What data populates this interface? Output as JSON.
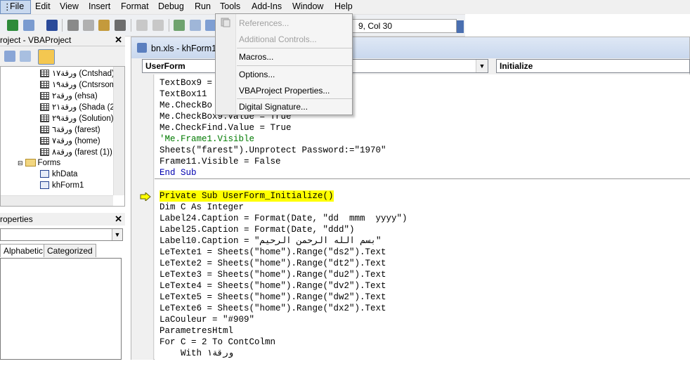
{
  "menubar": {
    "items": [
      "File",
      "Edit",
      "View",
      "Insert",
      "Format",
      "Debug",
      "Run",
      "Tools",
      "Add-Ins",
      "Window",
      "Help"
    ],
    "active": "Tools"
  },
  "toolbar": {
    "position_text": "9, Col 30"
  },
  "tools_menu": {
    "items": [
      {
        "label": "References...",
        "enabled": false
      },
      {
        "label": "Additional Controls...",
        "enabled": false
      },
      {
        "label": "Macros...",
        "enabled": true
      },
      {
        "label": "Options...",
        "enabled": true
      },
      {
        "label": "VBAProject Properties...",
        "enabled": true
      },
      {
        "label": "Digital Signature...",
        "enabled": true
      }
    ]
  },
  "project_explorer": {
    "title": "roject - VBAProject",
    "close_glyph": "✕",
    "tree": [
      {
        "label": "ورقة١٧ (Cntshad)",
        "type": "sheet"
      },
      {
        "label": "ورقة١٩ (Cntsrsom",
        "type": "sheet"
      },
      {
        "label": "ورقة٢ (ehsa)",
        "type": "sheet"
      },
      {
        "label": "ورقة٢١ (Shada (2",
        "type": "sheet"
      },
      {
        "label": "ورقة٢٩ (Solution)",
        "type": "sheet"
      },
      {
        "label": "ورقة٦ (farest)",
        "type": "sheet"
      },
      {
        "label": "ورقة٧ (home)",
        "type": "sheet"
      },
      {
        "label": "ورقة٨ (farest (1))",
        "type": "sheet"
      },
      {
        "label": "Forms",
        "type": "folder"
      },
      {
        "label": "khData",
        "type": "form"
      },
      {
        "label": "khForm1",
        "type": "form"
      }
    ]
  },
  "properties": {
    "title": "roperties",
    "tabs": [
      "Alphabetic",
      "Categorized"
    ]
  },
  "code_window": {
    "title": "bn.xls - khForm1",
    "object_combo": "UserForm",
    "proc_combo": "Initialize",
    "lines_before": [
      {
        "text": "TextBox9 =",
        "class": ""
      },
      {
        "text": "TextBox11",
        "class": ""
      },
      {
        "text": "Me.CheckBo",
        "class": ""
      },
      {
        "text": "Me.CheckBox9.Value = True",
        "class": ""
      },
      {
        "text": "Me.CheckFind.Value = True",
        "class": ""
      },
      {
        "text": "'Me.Frame1.Visible",
        "class": "cm"
      },
      {
        "text": "Sheets(\"farest\").Unprotect Password:=\"1970\"",
        "class": ""
      },
      {
        "text": "Frame11.Visible = False",
        "class": ""
      },
      {
        "text": "End Sub",
        "class": ""
      }
    ],
    "current_line": "Private Sub UserForm_Initialize()",
    "lines_after": [
      "Dim C As Integer",
      "Label24.Caption = Format(Date, \"dd  mmm  yyyy\")",
      "Label25.Caption = Format(Date, \"ddd\")",
      "Label10.Caption = \"بسم الله الرحمن الرحيم\"",
      "LeTexte1 = Sheets(\"home\").Range(\"ds2\").Text",
      "LeTexte2 = Sheets(\"home\").Range(\"dt2\").Text",
      "LeTexte3 = Sheets(\"home\").Range(\"du2\").Text",
      "LeTexte4 = Sheets(\"home\").Range(\"dv2\").Text",
      "LeTexte5 = Sheets(\"home\").Range(\"dw2\").Text",
      "LeTexte6 = Sheets(\"home\").Range(\"dx2\").Text",
      "LaCouleur = \"#909\"",
      "ParametresHtml",
      "For C = 2 To ContColmn",
      "    With ورقة١"
    ]
  }
}
